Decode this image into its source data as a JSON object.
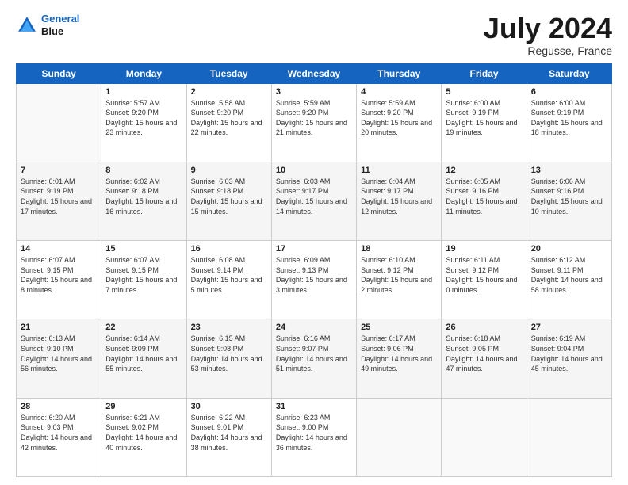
{
  "header": {
    "logo_line1": "General",
    "logo_line2": "Blue",
    "month": "July 2024",
    "location": "Regusse, France"
  },
  "days_of_week": [
    "Sunday",
    "Monday",
    "Tuesday",
    "Wednesday",
    "Thursday",
    "Friday",
    "Saturday"
  ],
  "weeks": [
    [
      {
        "day": "",
        "sunrise": "",
        "sunset": "",
        "daylight": ""
      },
      {
        "day": "1",
        "sunrise": "Sunrise: 5:57 AM",
        "sunset": "Sunset: 9:20 PM",
        "daylight": "Daylight: 15 hours and 23 minutes."
      },
      {
        "day": "2",
        "sunrise": "Sunrise: 5:58 AM",
        "sunset": "Sunset: 9:20 PM",
        "daylight": "Daylight: 15 hours and 22 minutes."
      },
      {
        "day": "3",
        "sunrise": "Sunrise: 5:59 AM",
        "sunset": "Sunset: 9:20 PM",
        "daylight": "Daylight: 15 hours and 21 minutes."
      },
      {
        "day": "4",
        "sunrise": "Sunrise: 5:59 AM",
        "sunset": "Sunset: 9:20 PM",
        "daylight": "Daylight: 15 hours and 20 minutes."
      },
      {
        "day": "5",
        "sunrise": "Sunrise: 6:00 AM",
        "sunset": "Sunset: 9:19 PM",
        "daylight": "Daylight: 15 hours and 19 minutes."
      },
      {
        "day": "6",
        "sunrise": "Sunrise: 6:00 AM",
        "sunset": "Sunset: 9:19 PM",
        "daylight": "Daylight: 15 hours and 18 minutes."
      }
    ],
    [
      {
        "day": "7",
        "sunrise": "Sunrise: 6:01 AM",
        "sunset": "Sunset: 9:19 PM",
        "daylight": "Daylight: 15 hours and 17 minutes."
      },
      {
        "day": "8",
        "sunrise": "Sunrise: 6:02 AM",
        "sunset": "Sunset: 9:18 PM",
        "daylight": "Daylight: 15 hours and 16 minutes."
      },
      {
        "day": "9",
        "sunrise": "Sunrise: 6:03 AM",
        "sunset": "Sunset: 9:18 PM",
        "daylight": "Daylight: 15 hours and 15 minutes."
      },
      {
        "day": "10",
        "sunrise": "Sunrise: 6:03 AM",
        "sunset": "Sunset: 9:17 PM",
        "daylight": "Daylight: 15 hours and 14 minutes."
      },
      {
        "day": "11",
        "sunrise": "Sunrise: 6:04 AM",
        "sunset": "Sunset: 9:17 PM",
        "daylight": "Daylight: 15 hours and 12 minutes."
      },
      {
        "day": "12",
        "sunrise": "Sunrise: 6:05 AM",
        "sunset": "Sunset: 9:16 PM",
        "daylight": "Daylight: 15 hours and 11 minutes."
      },
      {
        "day": "13",
        "sunrise": "Sunrise: 6:06 AM",
        "sunset": "Sunset: 9:16 PM",
        "daylight": "Daylight: 15 hours and 10 minutes."
      }
    ],
    [
      {
        "day": "14",
        "sunrise": "Sunrise: 6:07 AM",
        "sunset": "Sunset: 9:15 PM",
        "daylight": "Daylight: 15 hours and 8 minutes."
      },
      {
        "day": "15",
        "sunrise": "Sunrise: 6:07 AM",
        "sunset": "Sunset: 9:15 PM",
        "daylight": "Daylight: 15 hours and 7 minutes."
      },
      {
        "day": "16",
        "sunrise": "Sunrise: 6:08 AM",
        "sunset": "Sunset: 9:14 PM",
        "daylight": "Daylight: 15 hours and 5 minutes."
      },
      {
        "day": "17",
        "sunrise": "Sunrise: 6:09 AM",
        "sunset": "Sunset: 9:13 PM",
        "daylight": "Daylight: 15 hours and 3 minutes."
      },
      {
        "day": "18",
        "sunrise": "Sunrise: 6:10 AM",
        "sunset": "Sunset: 9:12 PM",
        "daylight": "Daylight: 15 hours and 2 minutes."
      },
      {
        "day": "19",
        "sunrise": "Sunrise: 6:11 AM",
        "sunset": "Sunset: 9:12 PM",
        "daylight": "Daylight: 15 hours and 0 minutes."
      },
      {
        "day": "20",
        "sunrise": "Sunrise: 6:12 AM",
        "sunset": "Sunset: 9:11 PM",
        "daylight": "Daylight: 14 hours and 58 minutes."
      }
    ],
    [
      {
        "day": "21",
        "sunrise": "Sunrise: 6:13 AM",
        "sunset": "Sunset: 9:10 PM",
        "daylight": "Daylight: 14 hours and 56 minutes."
      },
      {
        "day": "22",
        "sunrise": "Sunrise: 6:14 AM",
        "sunset": "Sunset: 9:09 PM",
        "daylight": "Daylight: 14 hours and 55 minutes."
      },
      {
        "day": "23",
        "sunrise": "Sunrise: 6:15 AM",
        "sunset": "Sunset: 9:08 PM",
        "daylight": "Daylight: 14 hours and 53 minutes."
      },
      {
        "day": "24",
        "sunrise": "Sunrise: 6:16 AM",
        "sunset": "Sunset: 9:07 PM",
        "daylight": "Daylight: 14 hours and 51 minutes."
      },
      {
        "day": "25",
        "sunrise": "Sunrise: 6:17 AM",
        "sunset": "Sunset: 9:06 PM",
        "daylight": "Daylight: 14 hours and 49 minutes."
      },
      {
        "day": "26",
        "sunrise": "Sunrise: 6:18 AM",
        "sunset": "Sunset: 9:05 PM",
        "daylight": "Daylight: 14 hours and 47 minutes."
      },
      {
        "day": "27",
        "sunrise": "Sunrise: 6:19 AM",
        "sunset": "Sunset: 9:04 PM",
        "daylight": "Daylight: 14 hours and 45 minutes."
      }
    ],
    [
      {
        "day": "28",
        "sunrise": "Sunrise: 6:20 AM",
        "sunset": "Sunset: 9:03 PM",
        "daylight": "Daylight: 14 hours and 42 minutes."
      },
      {
        "day": "29",
        "sunrise": "Sunrise: 6:21 AM",
        "sunset": "Sunset: 9:02 PM",
        "daylight": "Daylight: 14 hours and 40 minutes."
      },
      {
        "day": "30",
        "sunrise": "Sunrise: 6:22 AM",
        "sunset": "Sunset: 9:01 PM",
        "daylight": "Daylight: 14 hours and 38 minutes."
      },
      {
        "day": "31",
        "sunrise": "Sunrise: 6:23 AM",
        "sunset": "Sunset: 9:00 PM",
        "daylight": "Daylight: 14 hours and 36 minutes."
      },
      {
        "day": "",
        "sunrise": "",
        "sunset": "",
        "daylight": ""
      },
      {
        "day": "",
        "sunrise": "",
        "sunset": "",
        "daylight": ""
      },
      {
        "day": "",
        "sunrise": "",
        "sunset": "",
        "daylight": ""
      }
    ]
  ]
}
